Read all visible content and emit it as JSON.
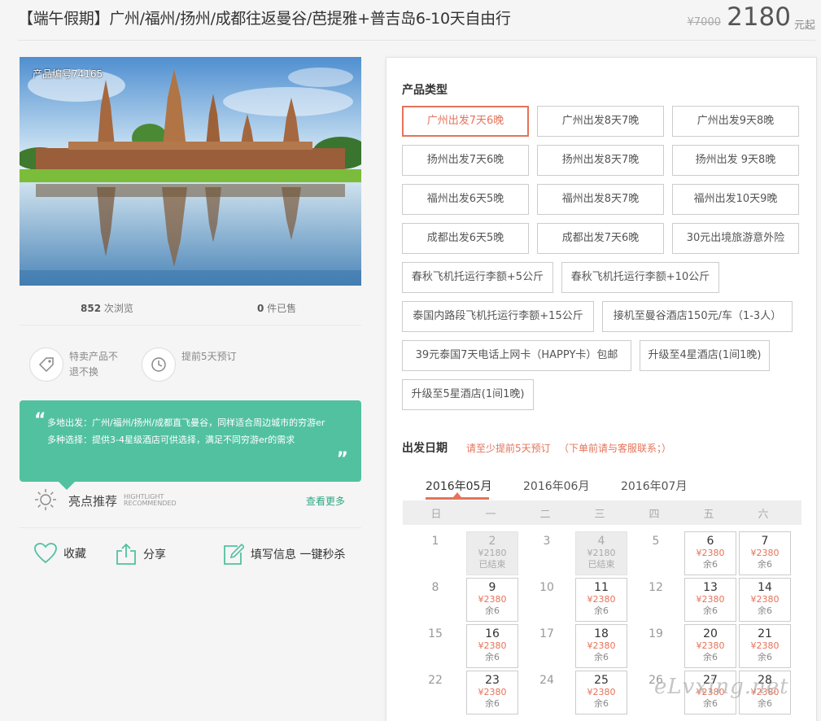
{
  "header": {
    "title": "【端午假期】广州/福州/扬州/成都往返曼谷/芭提雅+普吉岛6-10天自由行",
    "old_price": "¥7000",
    "price": "2180",
    "price_unit": "元起"
  },
  "hero": {
    "product_no": "产品编号74165"
  },
  "stats": {
    "views_count": "852",
    "views_label": " 次浏览",
    "sold_count": "0",
    "sold_label": " 件已售"
  },
  "policies": [
    {
      "icon": "tag-icon",
      "text": "特卖产品不退不换"
    },
    {
      "icon": "clock-icon",
      "text": "提前5天预订"
    }
  ],
  "highlight": {
    "line1": "多地出发：广州/福州/扬州/成都直飞曼谷，同样适合周边城市的穷游er",
    "line2": "多种选择：提供3-4星级酒店可供选择，满足不同穷游er的需求"
  },
  "recommend": {
    "title": "亮点推荐",
    "sub1": "HIGHTLIGHT",
    "sub2": "RECOMMENDED",
    "more": "查看更多"
  },
  "actions": {
    "favorite": "收藏",
    "share": "分享",
    "fill": "填写信息 一键秒杀"
  },
  "product_type": {
    "title": "产品类型",
    "selected": "广州出发7天6晚",
    "options": [
      "广州出发7天6晚",
      "广州出发8天7晚",
      "广州出发9天8晚",
      "扬州出发7天6晚",
      "扬州出发8天7晚",
      "扬州出发 9天8晚",
      "福州出发6天5晚",
      "福州出发8天7晚",
      "福州出发10天9晚",
      "成都出发6天5晚",
      "成都出发7天6晚",
      "30元出境旅游意外险",
      "春秋飞机托运行李额+5公斤",
      "春秋飞机托运行李额+10公斤",
      "泰国内路段飞机托运行李额+15公斤",
      "接机至曼谷酒店150元/车（1-3人）",
      "39元泰国7天电话上网卡（HAPPY卡）包邮",
      "升级至4星酒店(1间1晚)",
      "升级至5星酒店(1间1晚)"
    ]
  },
  "departure": {
    "title": "出发日期",
    "note1": "请至少提前5天预订",
    "note2": "（下单前请与客服联系；）",
    "months": [
      "2016年05月",
      "2016年06月",
      "2016年07月"
    ],
    "active_month": "2016年05月",
    "weekdays": [
      "日",
      "一",
      "二",
      "三",
      "四",
      "五",
      "六"
    ],
    "weeks": [
      [
        {
          "day": "1"
        },
        {
          "day": "2",
          "price": "¥2180",
          "status": "已结束",
          "ended": true
        },
        {
          "day": "3"
        },
        {
          "day": "4",
          "price": "¥2180",
          "status": "已结束",
          "ended": true
        },
        {
          "day": "5"
        },
        {
          "day": "6",
          "price": "¥2380",
          "status": "余6"
        },
        {
          "day": "7",
          "price": "¥2380",
          "status": "余6"
        }
      ],
      [
        {
          "day": "8"
        },
        {
          "day": "9",
          "price": "¥2380",
          "status": "余6"
        },
        {
          "day": "10"
        },
        {
          "day": "11",
          "price": "¥2380",
          "status": "余6"
        },
        {
          "day": "12"
        },
        {
          "day": "13",
          "price": "¥2380",
          "status": "余6"
        },
        {
          "day": "14",
          "price": "¥2380",
          "status": "余6"
        }
      ],
      [
        {
          "day": "15"
        },
        {
          "day": "16",
          "price": "¥2380",
          "status": "余6"
        },
        {
          "day": "17"
        },
        {
          "day": "18",
          "price": "¥2380",
          "status": "余6"
        },
        {
          "day": "19"
        },
        {
          "day": "20",
          "price": "¥2380",
          "status": "余6"
        },
        {
          "day": "21",
          "price": "¥2380",
          "status": "余6"
        }
      ],
      [
        {
          "day": "22"
        },
        {
          "day": "23",
          "price": "¥2380",
          "status": "余6"
        },
        {
          "day": "24"
        },
        {
          "day": "25",
          "price": "¥2380",
          "status": "余6"
        },
        {
          "day": "26"
        },
        {
          "day": "27",
          "price": "¥2380",
          "status": "余6"
        },
        {
          "day": "28",
          "price": "¥2380",
          "status": "余6"
        }
      ]
    ]
  },
  "watermark": "eLvxing.net",
  "colors": {
    "accent": "#e5735a",
    "green": "#52c1a0",
    "link_green": "#2ea882"
  }
}
